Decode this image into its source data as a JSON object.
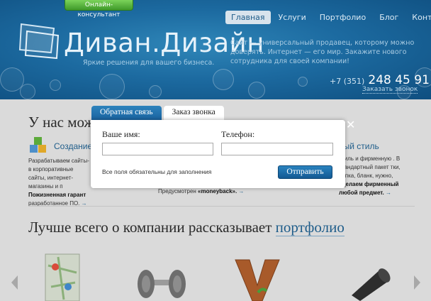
{
  "header": {
    "consultant_button": "Онлайн-консультант",
    "logo": {
      "text": "Диван.Дизайн",
      "tagline": "Яркие решения для вашего бизнеса."
    },
    "nav": [
      {
        "label": "Главная",
        "active": true
      },
      {
        "label": "Услуги",
        "active": false
      },
      {
        "label": "Портфолио",
        "active": false
      },
      {
        "label": "Блог",
        "active": false
      },
      {
        "label": "Контакты",
        "active": false
      }
    ],
    "description": "Сайт — универсальный продавец, которому можно доверять. Интернет — его мир. Закажите нового сотрудника для своей компании!",
    "phone": {
      "code": "+7 (351)",
      "number": "248 45 91"
    },
    "callback_link": "Заказать звонок"
  },
  "content": {
    "services_heading": "У нас мож",
    "service1": {
      "title": "Создание",
      "text_plain": "Разрабатываем сайты-в корпоративные сайты, интернет-магазины и п",
      "text_bold": "Пожизненная гарант",
      "text_tail": "разработанное ПО."
    },
    "service2": {
      "text_plain": "Предусмотрен",
      "text_bold": "«moneyback»."
    },
    "service3": {
      "title": "ный стиль",
      "text_plain": "стиль и фирменную . В стандартный пакет тки, папка, бланк, нужно,",
      "text_bold": "сделаем фирменный любой предмет."
    },
    "portfolio_heading": "Лучше всего о компании рассказывает",
    "portfolio_link": "портфолио",
    "arrow": "→"
  },
  "modal": {
    "tabs": [
      {
        "label": "Обратная связь"
      },
      {
        "label": "Заказ звонка"
      }
    ],
    "name_label": "Ваше имя:",
    "name_value": "",
    "phone_label": "Телефон:",
    "phone_value": "",
    "required_hint": "Все поля обязательны для заполнения",
    "submit_label": "Отправить",
    "close_symbol": "✕"
  },
  "colors": {
    "header_blue": "#1c6aa0",
    "link_blue": "#1f5d8a",
    "consult_green": "#4fae35",
    "dim_overlay": "#d9d9d9"
  }
}
